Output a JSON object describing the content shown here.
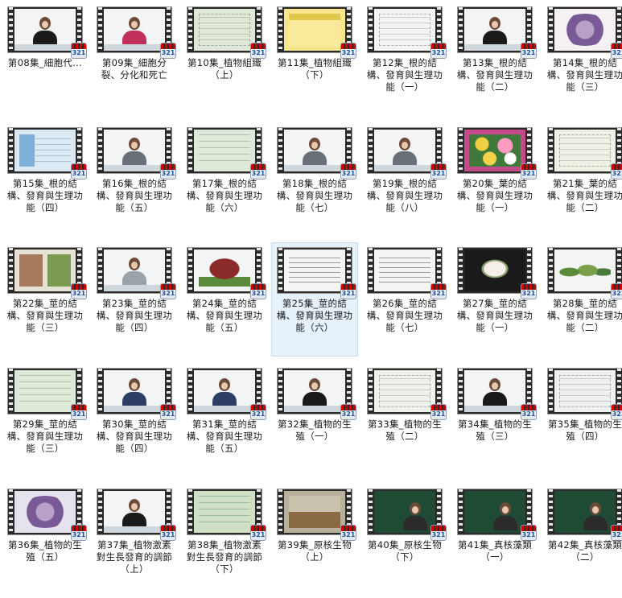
{
  "items": [
    {
      "label": "第08集_細胞代...",
      "thumb": "person",
      "bg": "#f2f4f6",
      "shirt": "#1a1a1a"
    },
    {
      "label": "第09集_細胞分裂、分化和死亡",
      "thumb": "person",
      "bg": "#f2f4f6",
      "shirt": "#c0305a"
    },
    {
      "label": "第10集_植物組織（上）",
      "thumb": "diagram",
      "bg": "#dfe7d6"
    },
    {
      "label": "第11集_植物組織（下）",
      "thumb": "slide-yellow",
      "bg": "#f6e58d"
    },
    {
      "label": "第12集_根的結構、發育與生理功能（一）",
      "thumb": "diagram",
      "bg": "#f4f4f2"
    },
    {
      "label": "第13集_根的結構、發育與生理功能（二）",
      "thumb": "person",
      "bg": "#f2f4f6",
      "shirt": "#1a1a1a"
    },
    {
      "label": "第14集_根的結構、發育與生理功能（三）",
      "thumb": "diagram-purple",
      "bg": "#f4f0f4"
    },
    {
      "label": "第15集_根的結構、發育與生理功能（四）",
      "thumb": "diagram-blue",
      "bg": "#dbe9f2"
    },
    {
      "label": "第16集_根的結構、發育與生理功能（五）",
      "thumb": "person",
      "bg": "#f2f4f6",
      "shirt": "#6a7078"
    },
    {
      "label": "第17集_根的結構、發育與生理功能（六）",
      "thumb": "slide-green",
      "bg": "#dfe9d9"
    },
    {
      "label": "第18集_根的結構、發育與生理功能（七）",
      "thumb": "person",
      "bg": "#f2f4f6",
      "shirt": "#6a7078"
    },
    {
      "label": "第19集_根的結構、發育與生理功能（八）",
      "thumb": "person",
      "bg": "#f2f4f6",
      "shirt": "#6a7078"
    },
    {
      "label": "第20集_葉的結構、發育與生理功能（一）",
      "thumb": "flowers",
      "bg": "#c44a8a"
    },
    {
      "label": "第21集_葉的結構、發育與生理功能（二）",
      "thumb": "diagram",
      "bg": "#eef2e6"
    },
    {
      "label": "第22集_莖的結構、發育與生理功能（三）",
      "thumb": "photos",
      "bg": "#e7e2d6"
    },
    {
      "label": "第23集_莖的結構、發育與生理功能（四）",
      "thumb": "person",
      "bg": "#f2f4f6",
      "shirt": "#9aa2aa"
    },
    {
      "label": "第24集_莖的結構、發育與生理功能（五）",
      "thumb": "tree",
      "bg": "#f2f4f6"
    },
    {
      "label": "第25集_莖的結構、發育與生理功能（六）",
      "thumb": "slide-text",
      "bg": "#f4f4f4"
    },
    {
      "label": "第26集_莖的結構、發育與生理功能（七）",
      "thumb": "slide-text",
      "bg": "#f4f4f4"
    },
    {
      "label": "第27集_莖的結構、發育與生理功能（一）",
      "thumb": "bulb",
      "bg": "#1a1a1a"
    },
    {
      "label": "第28集_莖的結構、發育與生理功能（二）",
      "thumb": "leaves",
      "bg": "#f4f4f2"
    },
    {
      "label": "第29集_莖的結構、發育與生理功能（三）",
      "thumb": "slide-green",
      "bg": "#dfe9d9"
    },
    {
      "label": "第30集_莖的結構、發育與生理功能（四）",
      "thumb": "person",
      "bg": "#f2f4f6",
      "shirt": "#2c3e66"
    },
    {
      "label": "第31集_莖的結構、發育與生理功能（五）",
      "thumb": "person",
      "bg": "#f2f4f6",
      "shirt": "#2c3e66"
    },
    {
      "label": "第32集_植物的生殖（一）",
      "thumb": "person",
      "bg": "#f2f4f6",
      "shirt": "#1a1a1a"
    },
    {
      "label": "第33集_植物的生殖（二）",
      "thumb": "diagram",
      "bg": "#eef2ea"
    },
    {
      "label": "第34集_植物的生殖（三）",
      "thumb": "person",
      "bg": "#f2f4f6",
      "shirt": "#1a1a1a"
    },
    {
      "label": "第35集_植物的生殖（四）",
      "thumb": "diagram",
      "bg": "#eef0f2"
    },
    {
      "label": "第36集_植物的生殖（五）",
      "thumb": "diagram-purple",
      "bg": "#e6e2ee"
    },
    {
      "label": "第37集_植物激素對生長發育的調節（上）",
      "thumb": "person",
      "bg": "#f2f4f6",
      "shirt": "#1a1a1a"
    },
    {
      "label": "第38集_植物激素對生長發育的調節（下）",
      "thumb": "slide-green",
      "bg": "#cfe0c6"
    },
    {
      "label": "第39集_原核生物（上）",
      "thumb": "roots",
      "bg": "#b8b09a"
    },
    {
      "label": "第40集_原核生物（下）",
      "thumb": "board",
      "bg": "#1f4a34"
    },
    {
      "label": "第41集_真核藻類（一）",
      "thumb": "board",
      "bg": "#1f4a34"
    },
    {
      "label": "第42集_真核藻類（二）",
      "thumb": "board",
      "bg": "#1f4a34"
    }
  ],
  "badge_text": "321",
  "selected_index": 17
}
